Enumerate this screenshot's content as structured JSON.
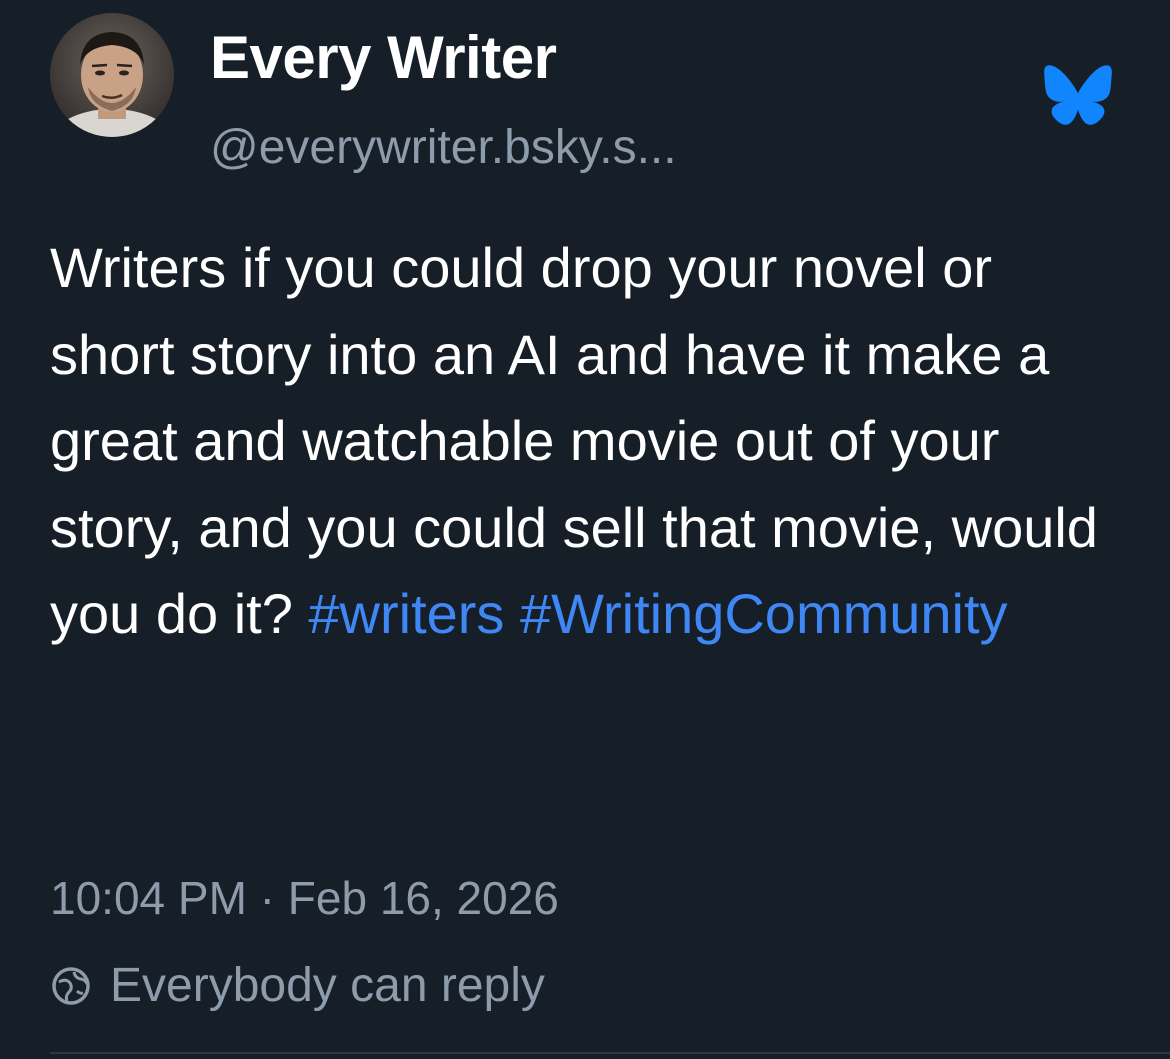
{
  "author": {
    "name": "Every Writer",
    "handle": "@everywriter.bsky.s..."
  },
  "post": {
    "text": "Writers if you could drop your novel or short story into an AI and have it make a great and watchable movie out of your story, and you could sell that movie, would you do it?",
    "hashtags": [
      "#writers",
      "#WritingCommunity"
    ],
    "timestamp": "10:04 PM · Feb 16, 2026",
    "reply_setting": "Everybody can reply"
  },
  "icons": {
    "brand": "bluesky-butterfly-icon",
    "reply": "reply-permission-icon"
  },
  "colors": {
    "background": "#161e27",
    "text": "#ffffff",
    "muted": "#8d9bab",
    "accent": "#3f87f5"
  }
}
